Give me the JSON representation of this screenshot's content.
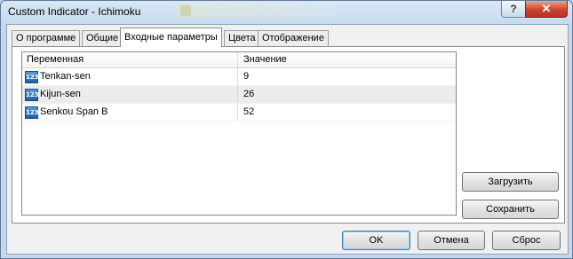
{
  "window": {
    "title": "Custom Indicator - Ichimoku",
    "help_glyph": "?",
    "close_glyph": "✕"
  },
  "tabs": [
    {
      "label": "О программе",
      "active": false
    },
    {
      "label": "Общие",
      "active": false
    },
    {
      "label": "Входные параметры",
      "active": true
    },
    {
      "label": "Цвета",
      "active": false
    },
    {
      "label": "Отображение",
      "active": false
    }
  ],
  "grid": {
    "headers": {
      "variable": "Переменная",
      "value": "Значение"
    },
    "row_icon_text": "123",
    "rows": [
      {
        "variable": "Tenkan-sen",
        "value": "9"
      },
      {
        "variable": "Kijun-sen",
        "value": "26"
      },
      {
        "variable": "Senkou Span B",
        "value": "52"
      }
    ]
  },
  "side_buttons": {
    "load": "Загрузить",
    "save": "Сохранить"
  },
  "footer_buttons": {
    "ok": "OK",
    "cancel": "Отмена",
    "reset": "Сброс"
  }
}
